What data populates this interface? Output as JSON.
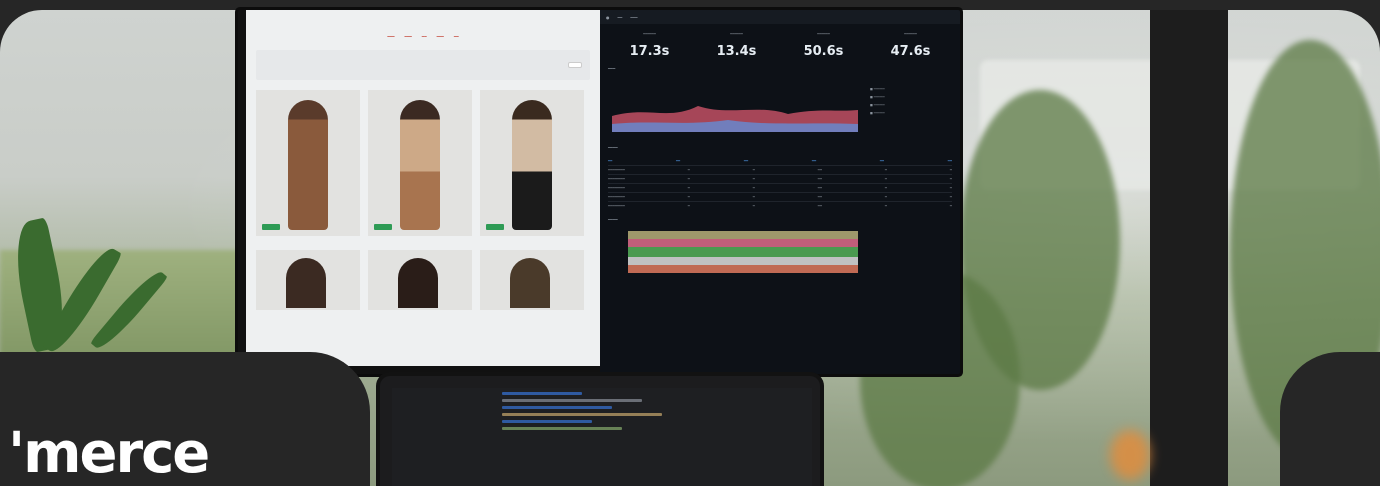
{
  "brand": {
    "wordmark": "'merce"
  },
  "monitor": {
    "shop": {
      "logo": "",
      "filter_label": "",
      "products": [
        {
          "name": ""
        },
        {
          "name": ""
        },
        {
          "name": ""
        }
      ]
    },
    "dashboard": {
      "stats": [
        {
          "value": "17.3s"
        },
        {
          "value": "13.4s"
        },
        {
          "value": "50.6s"
        },
        {
          "value": "47.6s"
        }
      ]
    }
  },
  "colors": {
    "page_bg": "#262626",
    "dashboard_bg": "#0d1117",
    "accent_green": "#2e9b55"
  }
}
